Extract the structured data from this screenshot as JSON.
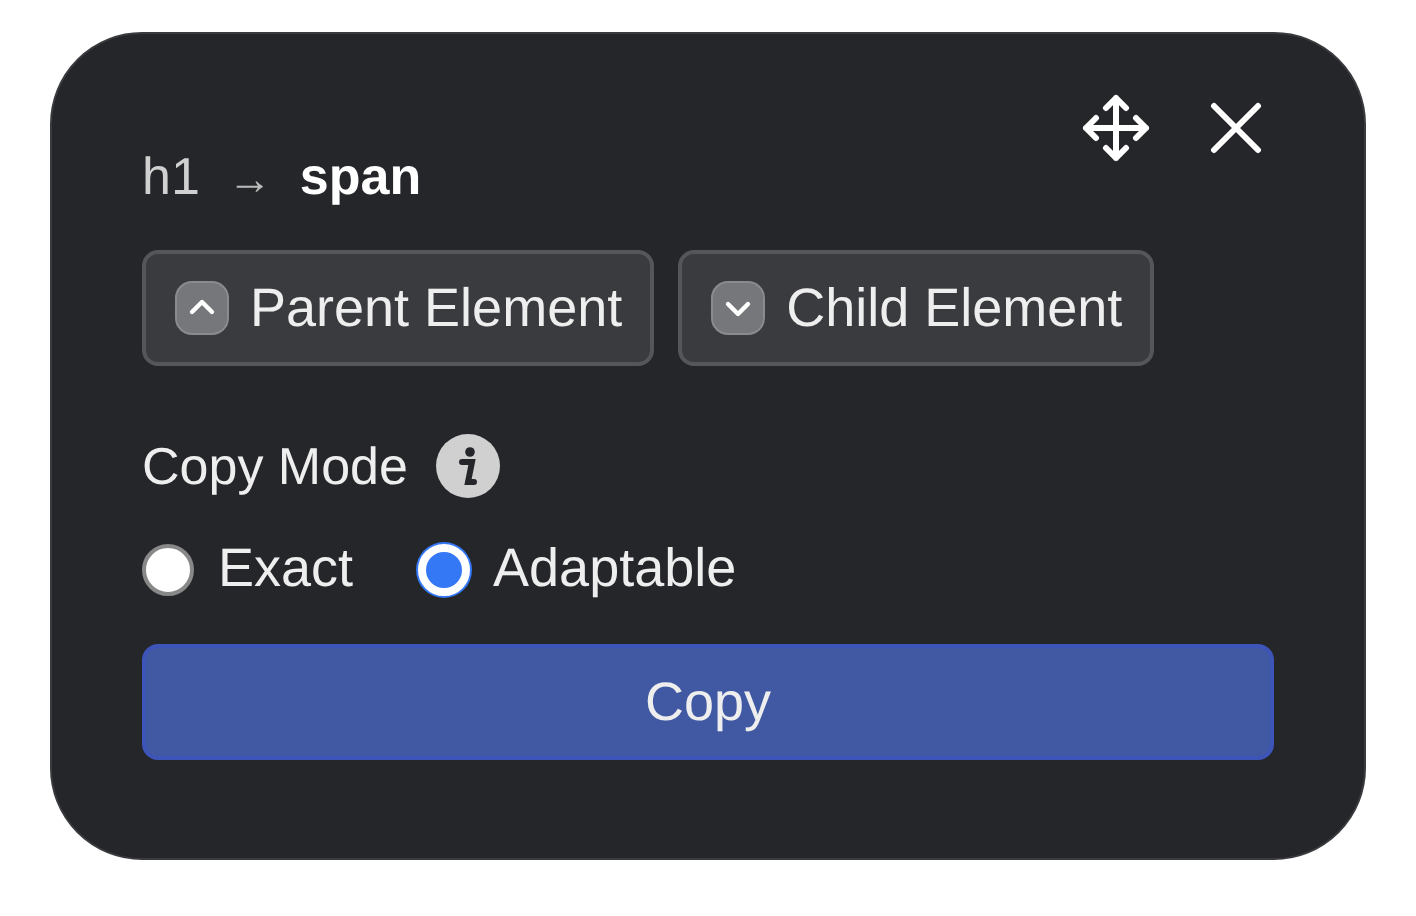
{
  "breadcrumb": {
    "from": "h1",
    "separator": "→",
    "to": "span"
  },
  "nav_buttons": [
    {
      "label": "Parent Element",
      "kind": "up"
    },
    {
      "label": "Child Element",
      "kind": "down"
    }
  ],
  "copy_mode": {
    "label": "Copy Mode",
    "options": [
      {
        "label": "Exact",
        "selected": false
      },
      {
        "label": "Adaptable",
        "selected": true
      }
    ]
  },
  "copy_button": "Copy"
}
